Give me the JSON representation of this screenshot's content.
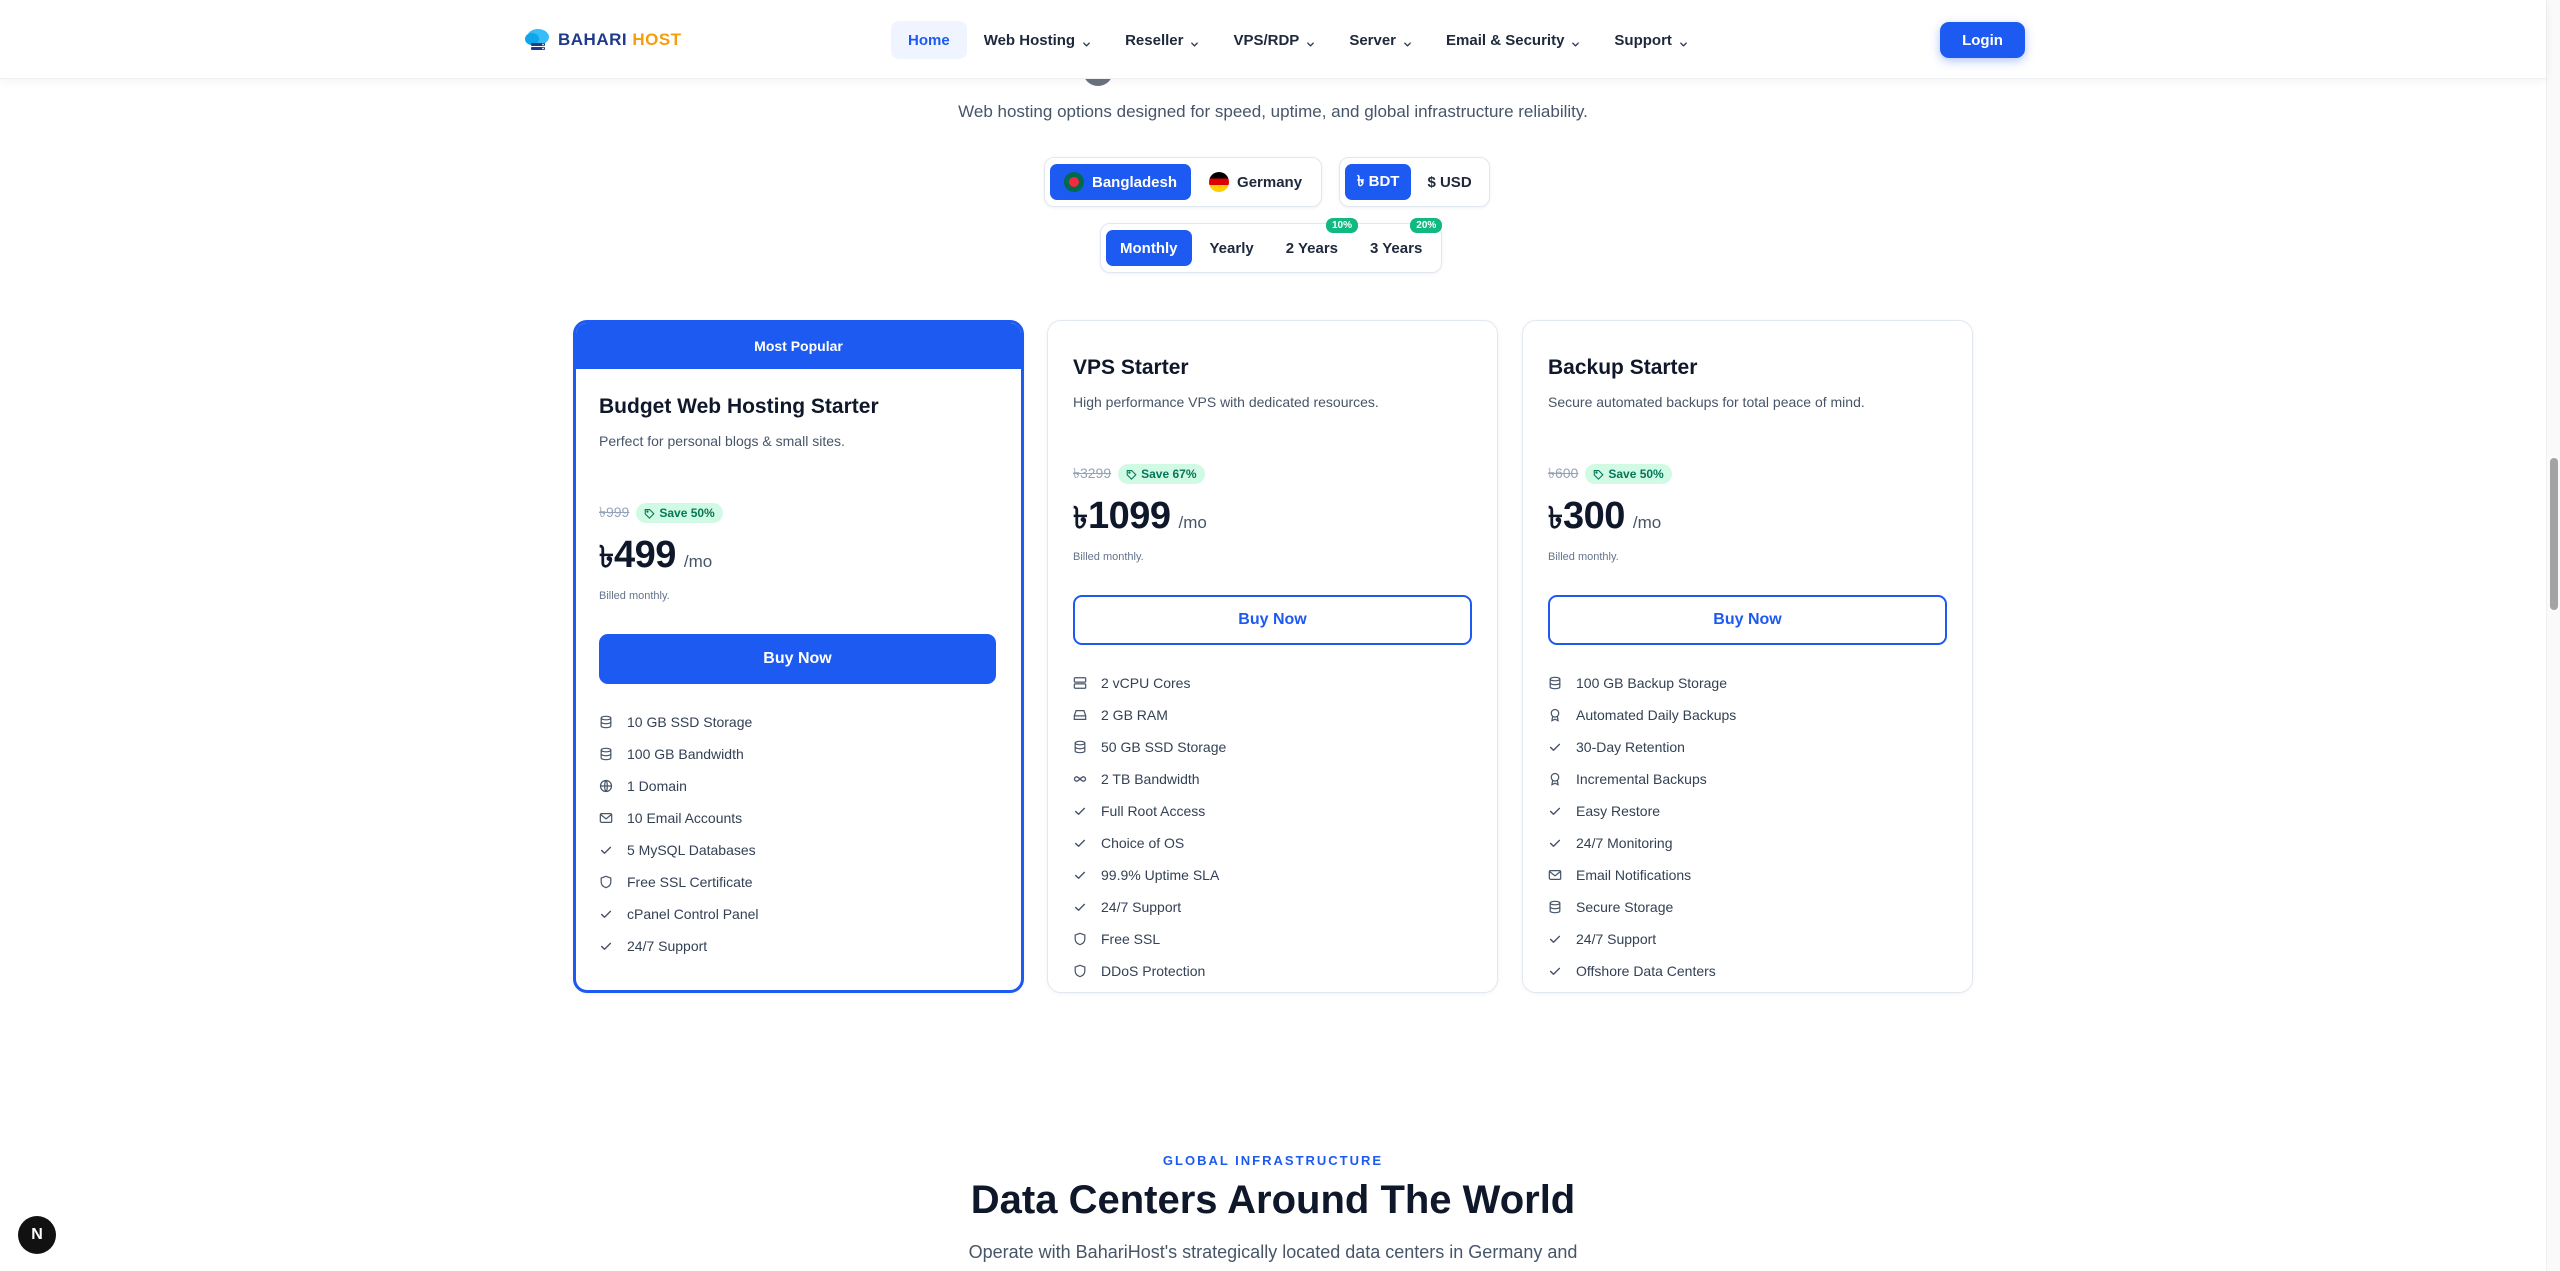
{
  "brand": {
    "name_part1": "BAHARI",
    "name_part2": "HOST"
  },
  "nav": {
    "items": [
      {
        "label": "Home",
        "active": true,
        "dropdown": false
      },
      {
        "label": "Web Hosting",
        "dropdown": true
      },
      {
        "label": "Reseller",
        "dropdown": true
      },
      {
        "label": "VPS/RDP",
        "dropdown": true
      },
      {
        "label": "Server",
        "dropdown": true
      },
      {
        "label": "Email & Security",
        "dropdown": true
      },
      {
        "label": "Support",
        "dropdown": true
      }
    ],
    "login_label": "Login"
  },
  "hero": {
    "subtitle": "Web hosting options designed for speed, uptime, and global infrastructure reliability."
  },
  "location_toggle": {
    "options": [
      "Bangladesh",
      "Germany"
    ],
    "selected": "Bangladesh"
  },
  "currency_toggle": {
    "options": [
      "৳ BDT",
      "$ USD"
    ],
    "selected": "৳ BDT"
  },
  "billing_toggle": {
    "options": [
      {
        "label": "Monthly",
        "badge": ""
      },
      {
        "label": "Yearly",
        "badge": ""
      },
      {
        "label": "2 Years",
        "badge": "10%"
      },
      {
        "label": "3 Years",
        "badge": "20%"
      }
    ],
    "selected": "Monthly"
  },
  "plans": [
    {
      "badge": "Most Popular",
      "title": "Budget Web Hosting Starter",
      "description": "Perfect for personal blogs & small sites.",
      "old_price": "৳999",
      "save": "Save 50%",
      "currency": "৳",
      "price": "499",
      "per": "/mo",
      "billed": "Billed monthly.",
      "button": "Buy Now",
      "features": [
        {
          "icon": "storage-icon",
          "text": "10 GB SSD Storage"
        },
        {
          "icon": "storage-icon",
          "text": "100 GB Bandwidth"
        },
        {
          "icon": "globe-icon",
          "text": "1 Domain"
        },
        {
          "icon": "mail-icon",
          "text": "10 Email Accounts"
        },
        {
          "icon": "check-icon",
          "text": "5 MySQL Databases"
        },
        {
          "icon": "shield-icon",
          "text": "Free SSL Certificate"
        },
        {
          "icon": "check-icon",
          "text": "cPanel Control Panel"
        },
        {
          "icon": "check-icon",
          "text": "24/7 Support"
        }
      ]
    },
    {
      "badge": "",
      "title": "VPS Starter",
      "description": "High performance VPS with dedicated resources.",
      "old_price": "৳3299",
      "save": "Save 67%",
      "currency": "৳",
      "price": "1099",
      "per": "/mo",
      "billed": "Billed monthly.",
      "button": "Buy Now",
      "features": [
        {
          "icon": "server-icon",
          "text": "2 vCPU Cores"
        },
        {
          "icon": "harddrive-icon",
          "text": "2 GB RAM"
        },
        {
          "icon": "storage-icon",
          "text": "50 GB SSD Storage"
        },
        {
          "icon": "infinity-icon",
          "text": "2 TB Bandwidth"
        },
        {
          "icon": "check-icon",
          "text": "Full Root Access"
        },
        {
          "icon": "check-icon",
          "text": "Choice of OS"
        },
        {
          "icon": "check-icon",
          "text": "99.9% Uptime SLA"
        },
        {
          "icon": "check-icon",
          "text": "24/7 Support"
        },
        {
          "icon": "shield-icon",
          "text": "Free SSL"
        },
        {
          "icon": "shield-icon",
          "text": "DDoS Protection"
        }
      ]
    },
    {
      "badge": "",
      "title": "Backup Starter",
      "description": "Secure automated backups for total peace of mind.",
      "old_price": "৳600",
      "save": "Save 50%",
      "currency": "৳",
      "price": "300",
      "per": "/mo",
      "billed": "Billed monthly.",
      "button": "Buy Now",
      "features": [
        {
          "icon": "storage-icon",
          "text": "100 GB Backup Storage"
        },
        {
          "icon": "award-icon",
          "text": "Automated Daily Backups"
        },
        {
          "icon": "check-icon",
          "text": "30-Day Retention"
        },
        {
          "icon": "award-icon",
          "text": "Incremental Backups"
        },
        {
          "icon": "check-icon",
          "text": "Easy Restore"
        },
        {
          "icon": "check-icon",
          "text": "24/7 Monitoring"
        },
        {
          "icon": "mail-icon",
          "text": "Email Notifications"
        },
        {
          "icon": "storage-icon",
          "text": "Secure Storage"
        },
        {
          "icon": "check-icon",
          "text": "24/7 Support"
        },
        {
          "icon": "check-icon",
          "text": "Offshore Data Centers"
        }
      ]
    }
  ],
  "datacenters": {
    "eyebrow": "GLOBAL INFRASTRUCTURE",
    "title": "Data Centers Around The World",
    "subtitle": "Operate with BahariHost's strategically located data centers in Germany and"
  },
  "dev_badge": "N",
  "colors": {
    "accent": "#1d5af1",
    "save_bg": "#d1fae5",
    "save_text": "#047857",
    "logo_orange": "#f59e0b",
    "logo_navy": "#1e3a8a"
  }
}
